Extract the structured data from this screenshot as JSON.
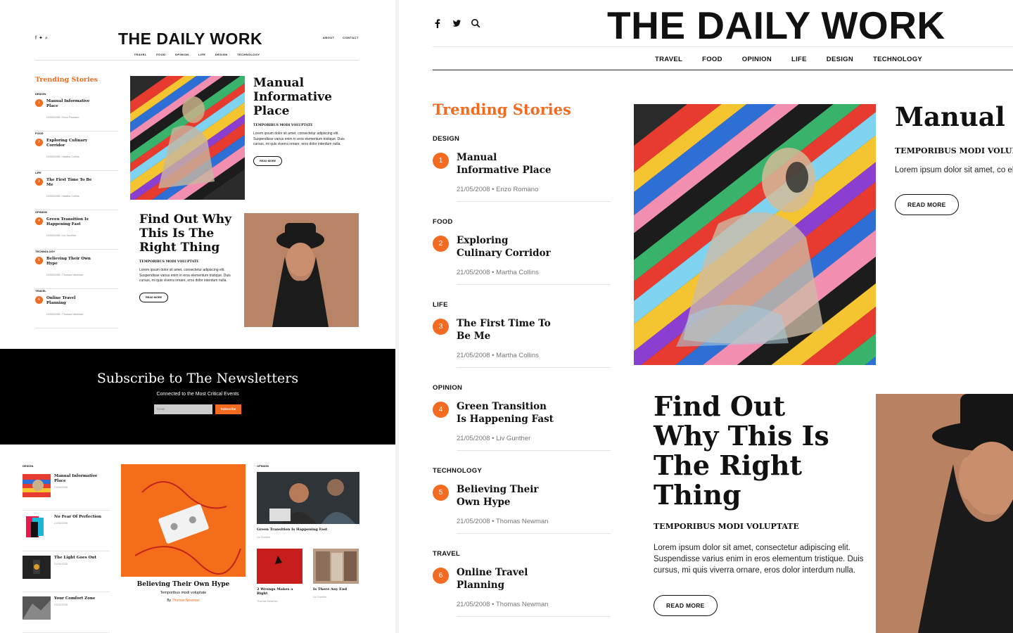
{
  "brand": {
    "logo": "THE DAILY WORK",
    "accent": "#f26b21"
  },
  "header": {
    "right_links": [
      "ABOUT",
      "CONTACT"
    ],
    "nav": [
      "TRAVEL",
      "FOOD",
      "OPINION",
      "LIFE",
      "DESIGN",
      "TECHNOLOGY"
    ],
    "icons": [
      "facebook-icon",
      "twitter-icon",
      "search-icon"
    ]
  },
  "trending": {
    "title": "Trending Stories",
    "items": [
      {
        "category": "DESIGN",
        "num": "1",
        "title": "Manual Informative Place",
        "date": "21/05/2008",
        "author": "Enzo Romano",
        "meta": "21/05/2008 • Enzo Romano"
      },
      {
        "category": "FOOD",
        "num": "2",
        "title": "Exploring Culinary Corridor",
        "date": "21/05/2008",
        "author": "Martha Collins",
        "meta": "21/05/2008 • Martha Collins"
      },
      {
        "category": "LIFE",
        "num": "3",
        "title": "The First Time To Be Me",
        "date": "21/05/2008",
        "author": "Martha Collins",
        "meta": "21/05/2008 • Martha Collins"
      },
      {
        "category": "OPINION",
        "num": "4",
        "title": "Green Transition Is Happening Fast",
        "date": "21/05/2008",
        "author": "Liv Gunther",
        "meta": "21/05/2008 • Liv Gunther"
      },
      {
        "category": "TECHNOLOGY",
        "num": "5",
        "title": "Believing Their Own Hype",
        "date": "21/05/2008",
        "author": "Thomas Newman",
        "meta": "21/05/2008 • Thomas Newman"
      },
      {
        "category": "TRAVEL",
        "num": "6",
        "title": "Online Travel Planning",
        "date": "21/05/2008",
        "author": "Thomas Newman",
        "meta": "21/05/2008 • Thomas Newman"
      }
    ]
  },
  "featured": [
    {
      "title": "Manual Informative Place",
      "title_zoom": "Manual Informat",
      "kicker": "TEMPORIBUS MODI VOLUPTATE",
      "kicker_zoom": "TEMPORIBUS MODI VOLUPTA",
      "excerpt": "Lorem ipsum dolor sit amet, consectetur adipiscing elit. Suspendisse varius enim in eros elementum tristique. Duis cursus, mi quis viverra ornare, eros dolor interdum nulla.",
      "excerpt_zoom": "Lorem ipsum dolor sit amet, co elit. Suspendisse varius enim in tristique. Duis cursus, mi quis v dolor interdum nulla.",
      "cta": "READ MORE"
    },
    {
      "title": "Find Out Why This Is The Right Thing",
      "kicker": "TEMPORIBUS MODI VOLUPTATE",
      "excerpt": "Lorem ipsum dolor sit amet, consectetur adipiscing elit. Suspendisse varius enim in eros elementum tristique. Duis cursus, mi quis viverra ornare, eros dolor interdum nulla.",
      "cta": "READ MORE"
    }
  ],
  "newsletter": {
    "title": "Subscribe to The Newsletters",
    "subtitle": "Connected to the Most Critical Events",
    "email_placeholder": "Email",
    "button": "Subscribe"
  },
  "bottom": {
    "design_cat": "DESIGN",
    "design_items": [
      {
        "title": "Manual Informative Place",
        "date": "21/05/2008"
      },
      {
        "title": "No Fear Of Perfection",
        "date": "21/05/2008"
      },
      {
        "title": "The Light Goes Out",
        "date": "21/05/2008"
      },
      {
        "title": "Your Comfort Zone",
        "date": "21/05/2008"
      }
    ],
    "center": {
      "title": "Believing Their Own Hype",
      "subtitle": "Temporibus modi voluptate",
      "by": "By",
      "author": "Thomas Newman"
    },
    "opinion_cat": "OPINION",
    "opinion_main": {
      "title": "Green Transition Is Happening Fast",
      "author": "Liv Gunther"
    },
    "opinion_pair": [
      {
        "title": "2 Wrongs Makes a Right",
        "author": "Thomas Newman"
      },
      {
        "title": "Is There Any End",
        "author": "Liv Gunther"
      }
    ]
  }
}
